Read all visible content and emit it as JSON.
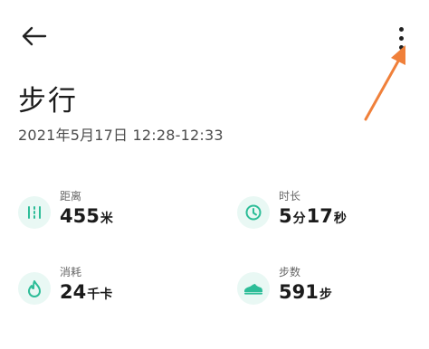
{
  "page": {
    "title": "步行",
    "datetime": "2021年5月17日 12:28-12:33"
  },
  "metrics": {
    "distance": {
      "label": "距离",
      "value": "455",
      "unit": "米"
    },
    "duration": {
      "label": "时长",
      "minutes": "5",
      "minutes_unit": "分",
      "seconds": "17",
      "seconds_unit": "秒"
    },
    "calories": {
      "label": "消耗",
      "value": "24",
      "unit": "千卡"
    },
    "steps": {
      "label": "步数",
      "value": "591",
      "unit": "步"
    }
  },
  "icons": {
    "back": "arrow-left-icon",
    "more": "more-vertical-icon",
    "distance": "distance-icon",
    "duration": "clock-icon",
    "calories": "flame-icon",
    "steps": "shoe-icon"
  },
  "colors": {
    "accent": "#2dbd98",
    "icon_bg": "#e9f8f4",
    "annotation_arrow": "#f0803a"
  }
}
